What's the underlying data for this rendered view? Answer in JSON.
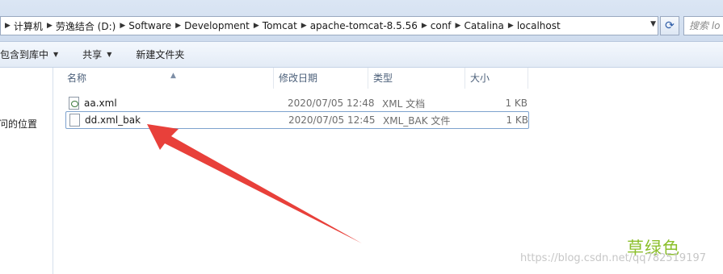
{
  "address_bar": {
    "breadcrumbs": [
      "计算机",
      "劳逸结合 (D:)",
      "Software",
      "Development",
      "Tomcat",
      "apache-tomcat-8.5.56",
      "conf",
      "Catalina",
      "localhost"
    ],
    "search_placeholder": "搜索 lo"
  },
  "toolbar": {
    "items": [
      {
        "label": "包含到库中",
        "has_dropdown": true
      },
      {
        "label": "共享",
        "has_dropdown": true
      },
      {
        "label": "新建文件夹",
        "has_dropdown": false
      }
    ]
  },
  "nav_pane": {
    "items": [
      "访问的位置"
    ]
  },
  "file_list": {
    "columns": [
      "名称",
      "修改日期",
      "类型",
      "大小"
    ],
    "rows": [
      {
        "name": "aa.xml",
        "modified": "2020/07/05 12:48",
        "type": "XML 文档",
        "size": "1 KB",
        "icon": "xml-file-icon",
        "selected": false
      },
      {
        "name": "dd.xml_bak",
        "modified": "2020/07/05 12:45",
        "type": "XML_BAK 文件",
        "size": "1 KB",
        "icon": "blank-file-icon",
        "selected": true
      }
    ]
  },
  "annotation": {
    "arrow_color": "#e8403a"
  },
  "watermarks": {
    "label": "草绿色",
    "url": "https://blog.csdn.net/qq782519197"
  }
}
